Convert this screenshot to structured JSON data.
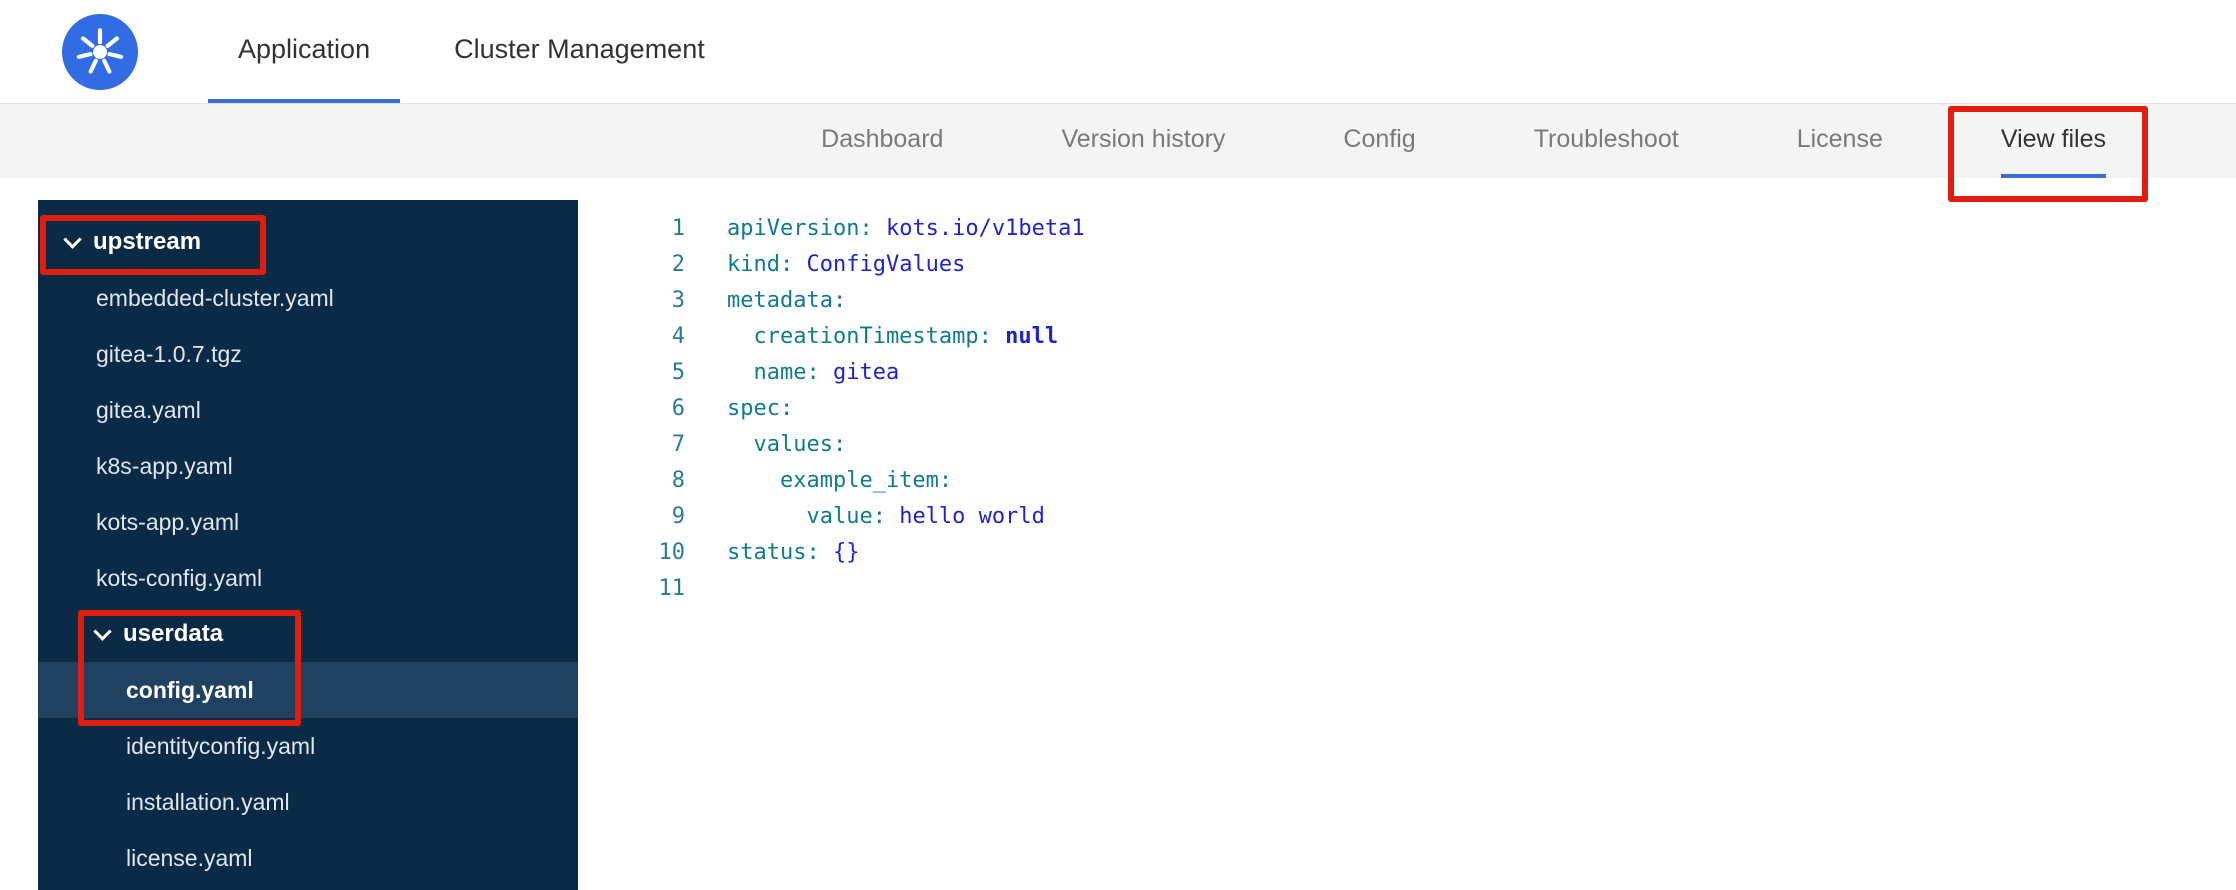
{
  "colors": {
    "accent_blue": "#3b6cde",
    "kubernetes_blue": "#326ce5",
    "sidebar_bg": "#0b2a46",
    "sidebar_selected": "#20415f",
    "yaml_key": "#0f7b8e",
    "yaml_value": "#1d25c9",
    "line_number": "#2a7a95",
    "annotation_red": "#e01e10",
    "subnav_bg": "#f4f4f4"
  },
  "app": {
    "logo_icon": "kubernetes-helm-wheel",
    "tabs": [
      {
        "label": "Application",
        "active": true
      },
      {
        "label": "Cluster Management",
        "active": false
      }
    ]
  },
  "subnav": {
    "items": [
      {
        "label": "Dashboard",
        "active": false,
        "annotated": false
      },
      {
        "label": "Version history",
        "active": false,
        "annotated": false
      },
      {
        "label": "Config",
        "active": false,
        "annotated": false
      },
      {
        "label": "Troubleshoot",
        "active": false,
        "annotated": false
      },
      {
        "label": "License",
        "active": false,
        "annotated": false
      },
      {
        "label": "View files",
        "active": true,
        "annotated": true
      }
    ]
  },
  "file_tree": {
    "items": [
      {
        "label": "upstream",
        "type": "folder",
        "expanded": true,
        "level": 0,
        "selected": false,
        "annotated": true
      },
      {
        "label": "embedded-cluster.yaml",
        "type": "file",
        "level": 1,
        "selected": false,
        "annotated": false
      },
      {
        "label": "gitea-1.0.7.tgz",
        "type": "file",
        "level": 1,
        "selected": false,
        "annotated": false
      },
      {
        "label": "gitea.yaml",
        "type": "file",
        "level": 1,
        "selected": false,
        "annotated": false
      },
      {
        "label": "k8s-app.yaml",
        "type": "file",
        "level": 1,
        "selected": false,
        "annotated": false
      },
      {
        "label": "kots-app.yaml",
        "type": "file",
        "level": 1,
        "selected": false,
        "annotated": false
      },
      {
        "label": "kots-config.yaml",
        "type": "file",
        "level": 1,
        "selected": false,
        "annotated": false
      },
      {
        "label": "userdata",
        "type": "folder",
        "expanded": true,
        "level": 1,
        "selected": false,
        "annotated": true
      },
      {
        "label": "config.yaml",
        "type": "file",
        "level": 2,
        "selected": true,
        "annotated": true
      },
      {
        "label": "identityconfig.yaml",
        "type": "file",
        "level": 2,
        "selected": false,
        "annotated": false
      },
      {
        "label": "installation.yaml",
        "type": "file",
        "level": 2,
        "selected": false,
        "annotated": false
      },
      {
        "label": "license.yaml",
        "type": "file",
        "level": 2,
        "selected": false,
        "annotated": false
      }
    ]
  },
  "editor": {
    "language": "yaml",
    "lines": [
      {
        "n": "1",
        "tokens": [
          {
            "c": "key",
            "t": "apiVersion:"
          },
          {
            "c": "val",
            "t": " kots.io/v1beta1"
          }
        ]
      },
      {
        "n": "2",
        "tokens": [
          {
            "c": "key",
            "t": "kind:"
          },
          {
            "c": "val",
            "t": " ConfigValues"
          }
        ]
      },
      {
        "n": "3",
        "tokens": [
          {
            "c": "key",
            "t": "metadata:"
          }
        ]
      },
      {
        "n": "4",
        "tokens": [
          {
            "c": "key",
            "t": "  creationTimestamp:"
          },
          {
            "c": "kw",
            "t": " null"
          }
        ]
      },
      {
        "n": "5",
        "tokens": [
          {
            "c": "key",
            "t": "  name:"
          },
          {
            "c": "val",
            "t": " gitea"
          }
        ]
      },
      {
        "n": "6",
        "tokens": [
          {
            "c": "key",
            "t": "spec:"
          }
        ]
      },
      {
        "n": "7",
        "tokens": [
          {
            "c": "key",
            "t": "  values:"
          }
        ]
      },
      {
        "n": "8",
        "tokens": [
          {
            "c": "key",
            "t": "    example_item:"
          }
        ]
      },
      {
        "n": "9",
        "tokens": [
          {
            "c": "key",
            "t": "      value:"
          },
          {
            "c": "val",
            "t": " hello world"
          }
        ]
      },
      {
        "n": "10",
        "tokens": [
          {
            "c": "key",
            "t": "status:"
          },
          {
            "c": "val",
            "t": " {}"
          }
        ]
      },
      {
        "n": "11",
        "tokens": []
      }
    ]
  },
  "annotations": [
    {
      "target": "upstream-folder"
    },
    {
      "target": "userdata-config-yaml"
    },
    {
      "target": "view-files-tab"
    }
  ]
}
